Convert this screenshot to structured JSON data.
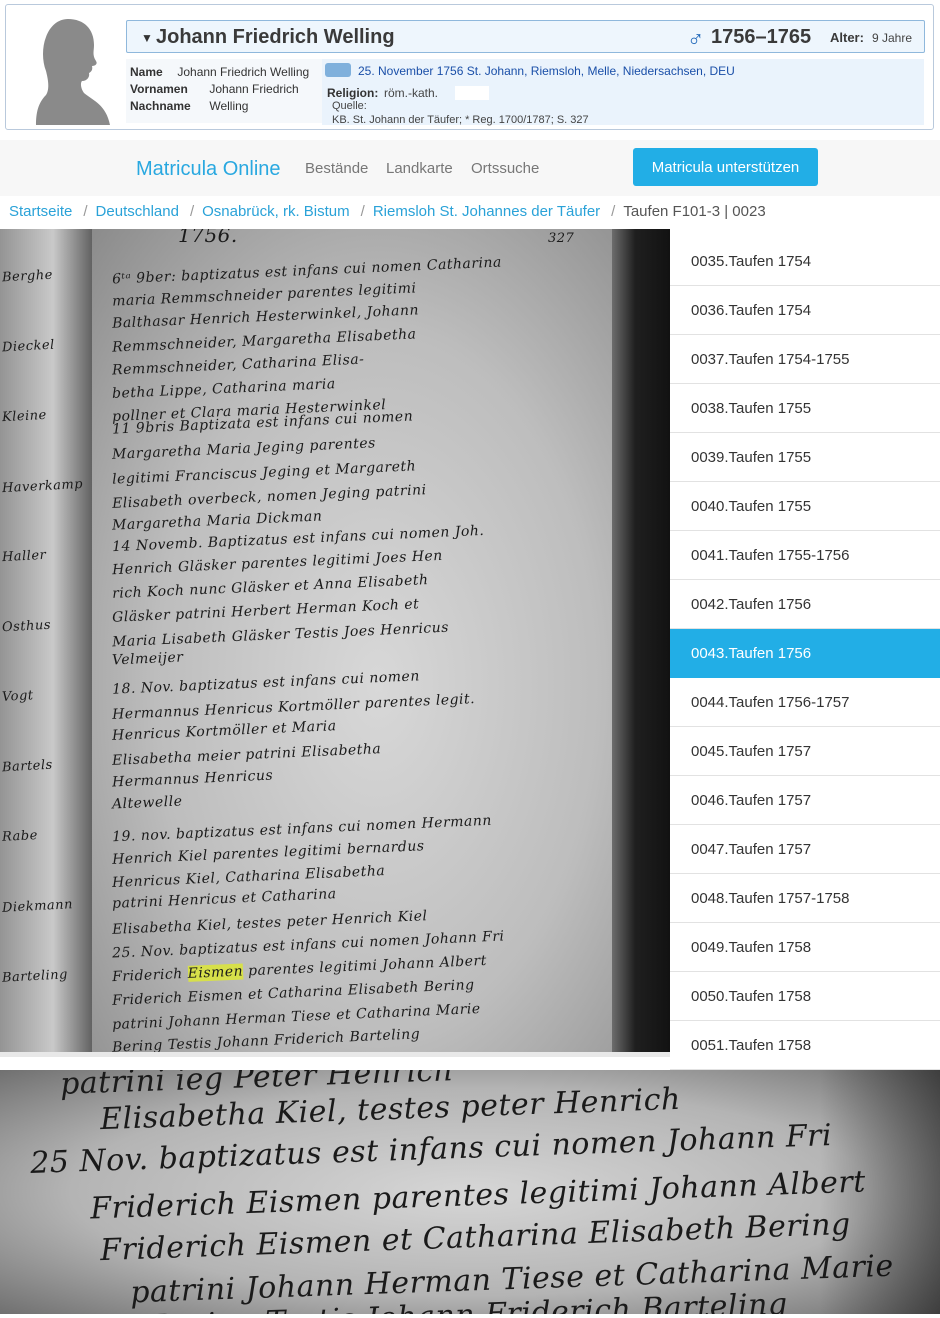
{
  "person": {
    "name": "Johann Friedrich Welling",
    "years": "1756–1765",
    "age_label": "Alter:",
    "age_value": "9 Jahre",
    "sex_symbol": "♂",
    "details": [
      {
        "label": "Name",
        "value": "Johann Friedrich Welling"
      },
      {
        "label": "Vornamen",
        "value": "Johann Friedrich"
      },
      {
        "label": "Nachname",
        "value": "Welling"
      }
    ],
    "event": {
      "date_place": "25. November 1756 St. Johann, Riemsloh, Melle, Niedersachsen, DEU",
      "religion_label": "Religion:",
      "religion_value": "röm.-kath.",
      "quelle_label": "Quelle:",
      "source": "KB. St. Johann der Täufer; * Reg. 1700/1787; S. 327"
    }
  },
  "nav": {
    "brand": "Matricula Online",
    "links": [
      "Bestände",
      "Landkarte",
      "Ortssuche"
    ],
    "support_button": "Matricula unterstützen"
  },
  "breadcrumb": {
    "items": [
      "Startseite",
      "Deutschland",
      "Osnabrück, rk. Bistum",
      "Riemsloh St. Johannes der Täufer"
    ],
    "current": "Taufen F101-3 | 0023"
  },
  "image_list": {
    "items": [
      "0035.Taufen 1754",
      "0036.Taufen 1754",
      "0037.Taufen 1754-1755",
      "0038.Taufen 1755",
      "0039.Taufen 1755",
      "0040.Taufen 1755",
      "0041.Taufen 1755-1756",
      "0042.Taufen 1756",
      "0043.Taufen 1756",
      "0044.Taufen 1756-1757",
      "0045.Taufen 1757",
      "0046.Taufen 1757",
      "0047.Taufen 1757",
      "0048.Taufen 1757-1758",
      "0049.Taufen 1758",
      "0050.Taufen 1758",
      "0051.Taufen 1758"
    ],
    "active_index": 8
  },
  "scan": {
    "year_header": "1756.",
    "page_number": "327",
    "lines": [
      "6ᵗᵃ 9ber: baptizatus est infans cui nomen Catharina",
      "maria Remmschneider parentes legitimi",
      "Balthasar Henrich Hesterwinkel, Johann",
      "Remmschneider, Margaretha Elisabetha",
      "Remmschneider, Catharina Elisa-",
      "betha Lippe, Catharina maria",
      "pollner et Clara maria Hesterwinkel",
      "11 9bris Baptizata est infans cui nomen",
      "Margaretha Maria Jeging parentes",
      "legitimi Franciscus Jeging et Margareth",
      "Elisabeth overbeck, nomen Jeging patrini",
      "Margaretha Maria Dickman",
      "14 Novemb. Baptizatus est infans cui nomen Joh.",
      "Henrich Gläsker parentes legitimi Joes Hen",
      "rich Koch nunc Gläsker et Anna Elisabeth",
      "Gläsker patrini Herbert Herman Koch et",
      "Maria Lisabeth Gläsker Testis Joes Henricus",
      "Velmeijer",
      "18. Nov. baptizatus est infans cui nomen",
      "Hermannus Henricus Kortmöller parentes legit.",
      "Henricus Kortmöller et Maria",
      "Elisabetha meier patrini Elisabetha",
      "Hermannus Henricus",
      "Altewelle",
      "19. nov. baptizatus est infans cui nomen Hermann",
      "Henrich Kiel parentes legitimi bernardus",
      "Henricus Kiel, Catharina Elisabetha",
      "patrini Henricus et Catharina",
      "Elisabetha Kiel, testes peter Henrich Kiel",
      "25. Nov. baptizatus est infans cui nomen Johann Fri",
      "Friderich Eismen parentes legitimi Johann Albert",
      "Friderich Eismen et Catharina Elisabeth Bering",
      "patrini Johann Herman Tiese et Catharina Marie",
      "Bering Testis Johann Friderich Barteling"
    ],
    "left_margin": [
      "Berghe",
      "Dieckel",
      "Kleine",
      "Haverkamp",
      "Haller",
      "Osthus",
      "Vogt",
      "Bartels",
      "Rabe",
      "Diekmann",
      "Barteling"
    ],
    "highlight_words": [
      "Eismen",
      "Bering"
    ]
  },
  "zoom": {
    "lines": [
      "patrini ieg Peter Henrich",
      "Elisabetha Kiel, testes peter Henrich",
      "25 Nov. baptizatus est infans cui nomen Johann Fri",
      "Friderich Eismen parentes legitimi Johann Albert",
      "Friderich Eismen et Catharina Elisabeth Bering",
      "patrini Johann Herman Tiese et Catharina Marie",
      "Bering Testis Johann Friderich Barteling"
    ]
  },
  "colors": {
    "accent": "#22aee6",
    "link": "#2aa2d8",
    "highlight": "#d7e04a",
    "male_symbol": "#1a64b8"
  }
}
